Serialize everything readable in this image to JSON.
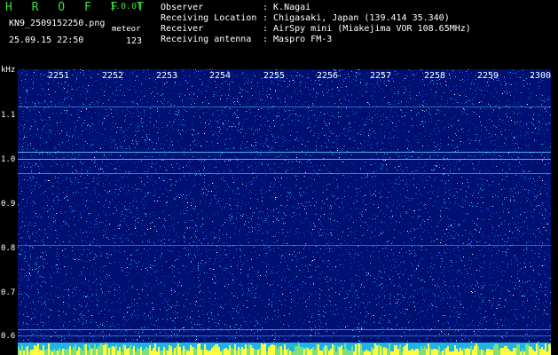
{
  "header": {
    "app_title": "H R O F F T",
    "version": "1.0.0f",
    "filename": "KN9_2509152250.png",
    "mode": "meteor",
    "datetime": "25.09.15 22:50",
    "count": "123",
    "info": [
      {
        "label": "Observer",
        "value": ": K.Nagai"
      },
      {
        "label": "Receiving Location",
        "value": ": Chigasaki, Japan (139.414 35.340)"
      },
      {
        "label": "Receiver",
        "value": ": AirSpy mini (Miakejima VOR 108.65MHz)"
      },
      {
        "label": "Receiving antenna",
        "value": ": Maspro FM-3"
      }
    ]
  },
  "axes": {
    "y_unit": "kHz",
    "y_ticks": [
      "1.1",
      "1.0",
      "0.9",
      "0.8",
      "0.7",
      "0.6"
    ],
    "x_ticks": [
      "2251",
      "2252",
      "2253",
      "2254",
      "2255",
      "2256",
      "2257",
      "2258",
      "2259",
      "2300"
    ]
  },
  "colors": {
    "background": "#001070",
    "noise_dim": "#1a4dd6",
    "noise_bright": "#38c7ff",
    "noise_hot": "#ffffff",
    "carrier": "#4ec6ff",
    "title_green": "#39e039",
    "bottom_band": "#ffff40"
  }
}
